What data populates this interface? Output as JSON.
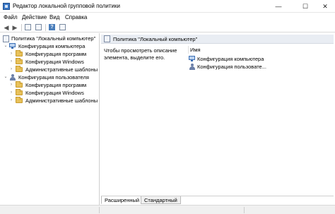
{
  "window": {
    "title": "Редактор локальной групповой политики",
    "minimize_glyph": "—",
    "maximize_glyph": "☐",
    "close_glyph": "✕"
  },
  "menu": [
    "Файл",
    "Действие",
    "Вид",
    "Справка"
  ],
  "toolbar": {
    "back_glyph": "◀",
    "forward_glyph": "▶",
    "icons": [
      "back-icon",
      "forward-icon",
      "show-hide-tree-icon",
      "properties-icon",
      "help-icon",
      "filter-icon"
    ]
  },
  "tree": {
    "root": "Политика \"Локальный компьютер\"",
    "computer": {
      "label": "Конфигурация компьютера",
      "children": [
        "Конфигурация программ",
        "Конфигурация Windows",
        "Административные шаблоны"
      ]
    },
    "user": {
      "label": "Конфигурация пользователя",
      "children": [
        "Конфигурация программ",
        "Конфигурация Windows",
        "Административные шаблоны"
      ]
    },
    "collapsed_glyph": "›",
    "expanded_glyph": "⌄"
  },
  "details": {
    "header": "Политика \"Локальный компьютер\"",
    "description": "Чтобы просмотреть описание элемента, выделите его.",
    "column_name": "Имя",
    "items": [
      "Конфигурация компьютера",
      "Конфигурация пользовате..."
    ]
  },
  "tabs": [
    "Расширенный",
    "Стандартный"
  ],
  "colors": {
    "header_bg": "#e9edf3",
    "folder": "#e8c15a",
    "accent": "#3c6fb5"
  }
}
